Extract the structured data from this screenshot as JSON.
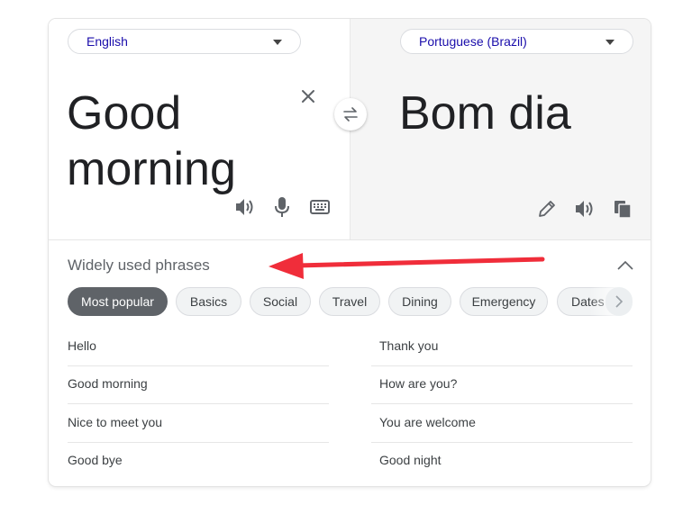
{
  "source": {
    "language": "English",
    "text_line1": "Good",
    "text_line2": "morning"
  },
  "target": {
    "language": "Portuguese (Brazil)",
    "text": "Bom dia"
  },
  "icons": {
    "clear": "close-icon",
    "swap": "swap-icon",
    "source_speaker": "speaker-icon",
    "microphone": "microphone-icon",
    "keyboard": "keyboard-icon",
    "edit": "pencil-icon",
    "target_speaker": "speaker-icon",
    "copy": "copy-icon",
    "collapse": "chevron-up-icon",
    "next": "chevron-right-icon"
  },
  "phrases": {
    "title": "Widely used phrases",
    "categories": [
      "Most popular",
      "Basics",
      "Social",
      "Travel",
      "Dining",
      "Emergency",
      "Dates"
    ],
    "selected_category": "Most popular",
    "left_column": [
      "Hello",
      "Good morning",
      "Nice to meet you",
      "Good bye"
    ],
    "right_column": [
      "Thank you",
      "How are you?",
      "You are welcome",
      "Good night"
    ]
  },
  "colors": {
    "annotation_arrow": "#f02d3a",
    "link": "#1a0dab",
    "active_chip": "#5f6368"
  }
}
